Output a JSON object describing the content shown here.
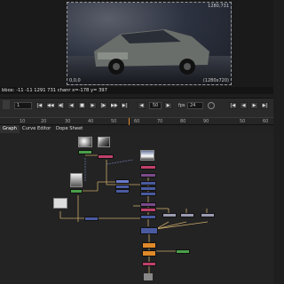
{
  "viewer": {
    "res_top": "1280,731",
    "res_bottom": "(1280x720)",
    "corner_label": "0,0,0"
  },
  "info_bar": {
    "text": "bbox: -11 -11 1291 731 chanr  x=-178 y= 397"
  },
  "timeline": {
    "frame_in": "1",
    "current_frame": "50",
    "fps_label": "fps",
    "fps_value": "24",
    "ruler_ticks": [
      "10",
      "20",
      "30",
      "40",
      "50",
      "60",
      "70",
      "80",
      "90",
      "50",
      "60"
    ]
  },
  "tabs": [
    {
      "label": "Graph",
      "active": true
    },
    {
      "label": "Curve Editor",
      "active": false
    },
    {
      "label": "Dope Sheet",
      "active": false
    }
  ],
  "colors": {
    "accent_orange": "#e08a2a",
    "node_purple": "#7a4a8a",
    "node_blue": "#4a5aa0",
    "node_green": "#4aa04a",
    "node_pink": "#c0406a"
  }
}
